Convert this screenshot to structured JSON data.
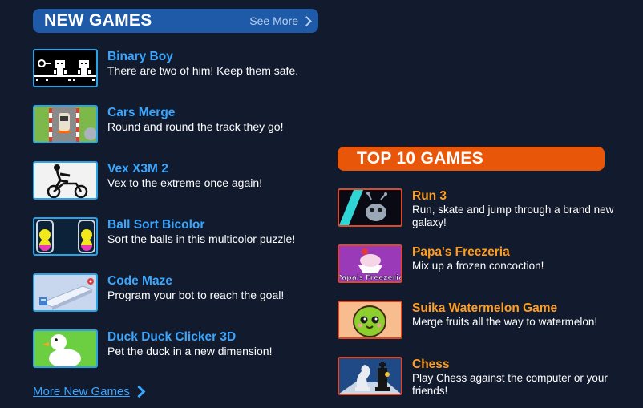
{
  "new_games": {
    "title": "NEW GAMES",
    "see_more": "See More",
    "more_link": "More New Games",
    "items": [
      {
        "title": "Binary Boy",
        "desc": "There are two of him! Keep them safe."
      },
      {
        "title": "Cars Merge",
        "desc": "Round and round the track they go!"
      },
      {
        "title": "Vex X3M 2",
        "desc": "Vex to the extreme once again!"
      },
      {
        "title": "Ball Sort Bicolor",
        "desc": "Sort the balls in this multicolor puzzle!"
      },
      {
        "title": "Code Maze",
        "desc": "Program your bot to reach the goal!"
      },
      {
        "title": "Duck Duck Clicker 3D",
        "desc": "Pet the duck in a new dimension!"
      }
    ]
  },
  "top_games": {
    "title": "TOP 10 GAMES",
    "items": [
      {
        "title": "Run 3",
        "desc": "Run, skate and jump through a brand new galaxy!"
      },
      {
        "title": "Papa's Freezeria",
        "desc": "Mix up a frozen concoction!",
        "thumb_text": "Papa's Freezeria"
      },
      {
        "title": "Suika Watermelon Game",
        "desc": "Merge fruits all the way to watermelon!"
      },
      {
        "title": "Chess",
        "desc": "Play Chess against the computer or your friends!"
      }
    ]
  },
  "colors": {
    "background": "#121a2e",
    "new_header": "#1e5aa8",
    "top_header": "#e8560a",
    "new_title": "#3aa7ff",
    "top_title": "#ff9d1f"
  }
}
